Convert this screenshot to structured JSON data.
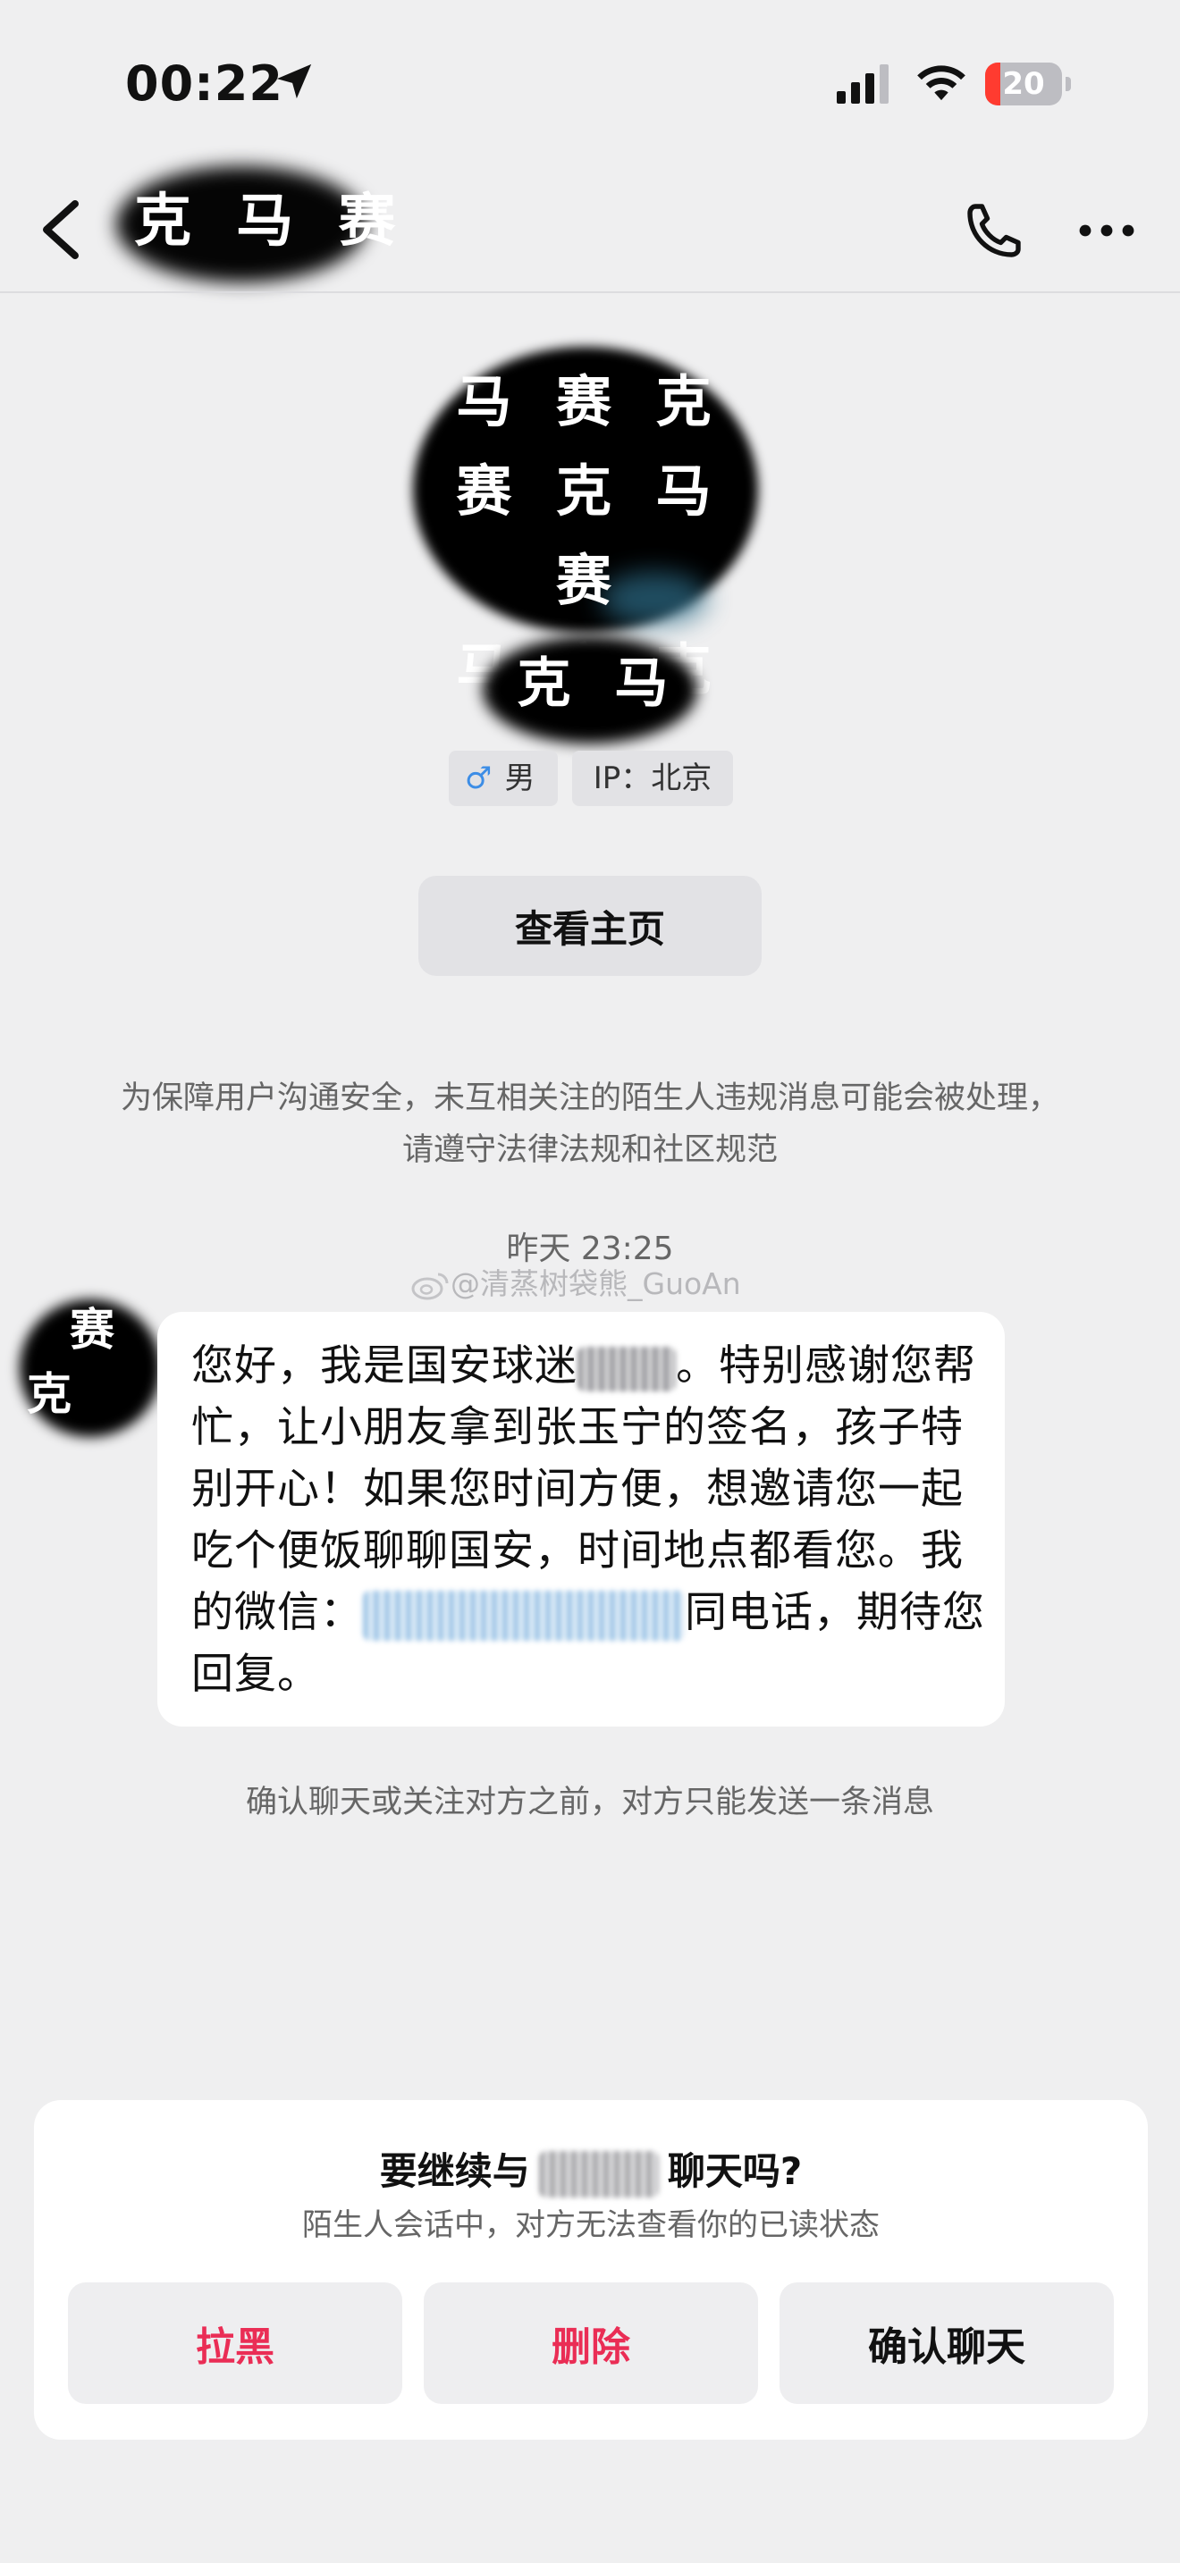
{
  "status_bar": {
    "time": "00:22",
    "battery_level": "20",
    "battery_fraction": 0.2
  },
  "nav": {
    "title_mosaic": "克 马 赛"
  },
  "profile": {
    "avatar_mosaic": [
      "马 赛 克",
      "赛 克 马 赛",
      "马 赛 克"
    ],
    "name_mosaic": "克 马",
    "gender_symbol": "♂",
    "gender": "男",
    "ip": "IP：北京",
    "home_button": "查看主页"
  },
  "notice": "为保障用户沟通安全，未互相关注的陌生人违规消息可能会被处理，请遵守法律法规和社区规范",
  "chat": {
    "timestamp": "昨天 23:25",
    "watermark": "@清蒸树袋熊_GuoAn",
    "avatar_mosaic": [
      "赛",
      "克"
    ],
    "message_part1": "您好，我是国安球迷",
    "message_part2": "。特别感谢您帮忙，让小朋友拿到张玉宁的签名，孩子特别开心！如果您时间方便，想邀请您一起吃个便饭聊聊国安，时间地点都看您。我的微信：",
    "message_part3": "同电话，期待您回复。"
  },
  "limit_note": "确认聊天或关注对方之前，对方只能发送一条消息",
  "card": {
    "title_prefix": "要继续与",
    "title_suffix": "聊天吗?",
    "subtitle": "陌生人会话中，对方无法查看你的已读状态",
    "block_label": "拉黑",
    "delete_label": "删除",
    "confirm_label": "确认聊天"
  },
  "colors": {
    "danger": "#ea2d55",
    "male": "#3c8de6",
    "background": "#efeff0"
  }
}
